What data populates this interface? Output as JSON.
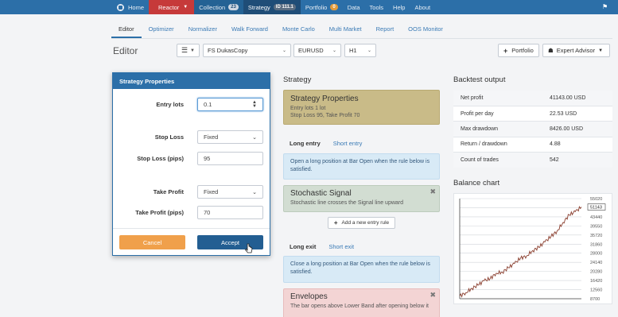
{
  "topnav": {
    "home": "Home",
    "reactor": "Reactor",
    "collection": "Collection",
    "collection_badge": "23",
    "strategy": "Strategy",
    "strategy_badge": "ID 111.1",
    "portfolio": "Portfolio",
    "portfolio_badge": "0",
    "data": "Data",
    "tools": "Tools",
    "help": "Help",
    "about": "About"
  },
  "subnav": [
    "Editor",
    "Optimizer",
    "Normalizer",
    "Walk Forward",
    "Monte Carlo",
    "Multi Market",
    "Report",
    "OOS Monitor"
  ],
  "page_title": "Editor",
  "toolbar": {
    "data_source": "FS DukasCopy",
    "symbol": "EURUSD",
    "period": "H1",
    "portfolio_button": "Portfolio",
    "expert_advisor_button": "Expert Advisor"
  },
  "dialog": {
    "title": "Strategy Properties",
    "entry_lots_label": "Entry lots",
    "entry_lots_value": "0.1",
    "stop_loss_label": "Stop Loss",
    "stop_loss_value": "Fixed",
    "stop_loss_pips_label": "Stop Loss (pips)",
    "stop_loss_pips_value": "95",
    "take_profit_label": "Take Profit",
    "take_profit_value": "Fixed",
    "take_profit_pips_label": "Take Profit (pips)",
    "take_profit_pips_value": "70",
    "cancel": "Cancel",
    "accept": "Accept"
  },
  "strategy": {
    "heading": "Strategy",
    "props_title": "Strategy Properties",
    "props_line1": "Entry lots 1 lot",
    "props_line2": "Stop Loss 95, Take Profit 70",
    "long_entry_tab": "Long entry",
    "short_entry_tab": "Short entry",
    "entry_info": "Open a long position at Bar Open when the rule below is satisfied.",
    "entry_rule_title": "Stochastic Signal",
    "entry_rule_desc": "Stochastic line crosses the Signal line upward",
    "add_rule": "Add a new entry rule",
    "long_exit_tab": "Long exit",
    "short_exit_tab": "Short exit",
    "exit_info": "Close a long position at Bar Open when the rule below is satisfied.",
    "exit_rule_title": "Envelopes",
    "exit_rule_desc": "The bar opens above Lower Band after opening below it"
  },
  "backtest": {
    "heading": "Backtest output",
    "rows": [
      {
        "label": "Net profit",
        "value": "41143.00 USD"
      },
      {
        "label": "Profit per day",
        "value": "22.53 USD"
      },
      {
        "label": "Max drawdown",
        "value": "8426.00 USD"
      },
      {
        "label": "Return / drawdown",
        "value": "4.88"
      },
      {
        "label": "Count of trades",
        "value": "542"
      }
    ]
  },
  "balance_chart_title": "Balance chart",
  "chart_data": {
    "type": "line",
    "title": "",
    "ylabel": "",
    "y_ticks": [
      55020,
      47330,
      43440,
      39550,
      35720,
      31860,
      28000,
      24140,
      20280,
      16420,
      12560,
      8700
    ],
    "current_label": "51143",
    "ylim": [
      8700,
      55020
    ],
    "x": [
      0,
      5,
      10,
      15,
      20,
      25,
      30,
      35,
      40,
      45,
      50,
      55,
      60,
      65,
      70,
      75,
      80,
      85,
      90,
      95,
      100
    ],
    "values": [
      10000,
      11500,
      13500,
      15000,
      17000,
      18000,
      20500,
      21000,
      23000,
      25000,
      27500,
      28500,
      31000,
      32500,
      35000,
      37500,
      40000,
      44000,
      47500,
      49000,
      51143
    ],
    "colors": {
      "line": "#8a3e2e",
      "grid": "#d0d4d9"
    }
  }
}
